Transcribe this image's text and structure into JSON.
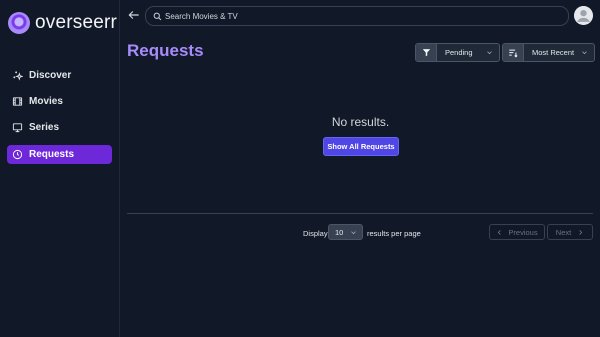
{
  "app": {
    "name": "overseerr"
  },
  "sidebar": {
    "items": [
      {
        "label": "Discover",
        "icon": "sparkles-icon",
        "active": false
      },
      {
        "label": "Movies",
        "icon": "film-icon",
        "active": false
      },
      {
        "label": "Series",
        "icon": "tv-icon",
        "active": false
      },
      {
        "label": "Requests",
        "icon": "clock-icon",
        "active": true
      }
    ]
  },
  "header": {
    "search_placeholder": "Search Movies & TV"
  },
  "main": {
    "title": "Requests",
    "filter": {
      "selected": "Pending",
      "icon": "funnel-icon"
    },
    "sort": {
      "selected": "Most Recent",
      "icon": "sort-lines-icon"
    },
    "empty_text": "No results.",
    "show_all_label": "Show All Requests"
  },
  "pagination": {
    "display_label": "Display",
    "per_page_value": "10",
    "per_page_suffix": "results per page",
    "previous_label": "Previous",
    "next_label": "Next"
  },
  "colors": {
    "background": "#111827",
    "accent": "#6d28d9",
    "title": "#a78bfa",
    "button": "#4f46e5"
  }
}
